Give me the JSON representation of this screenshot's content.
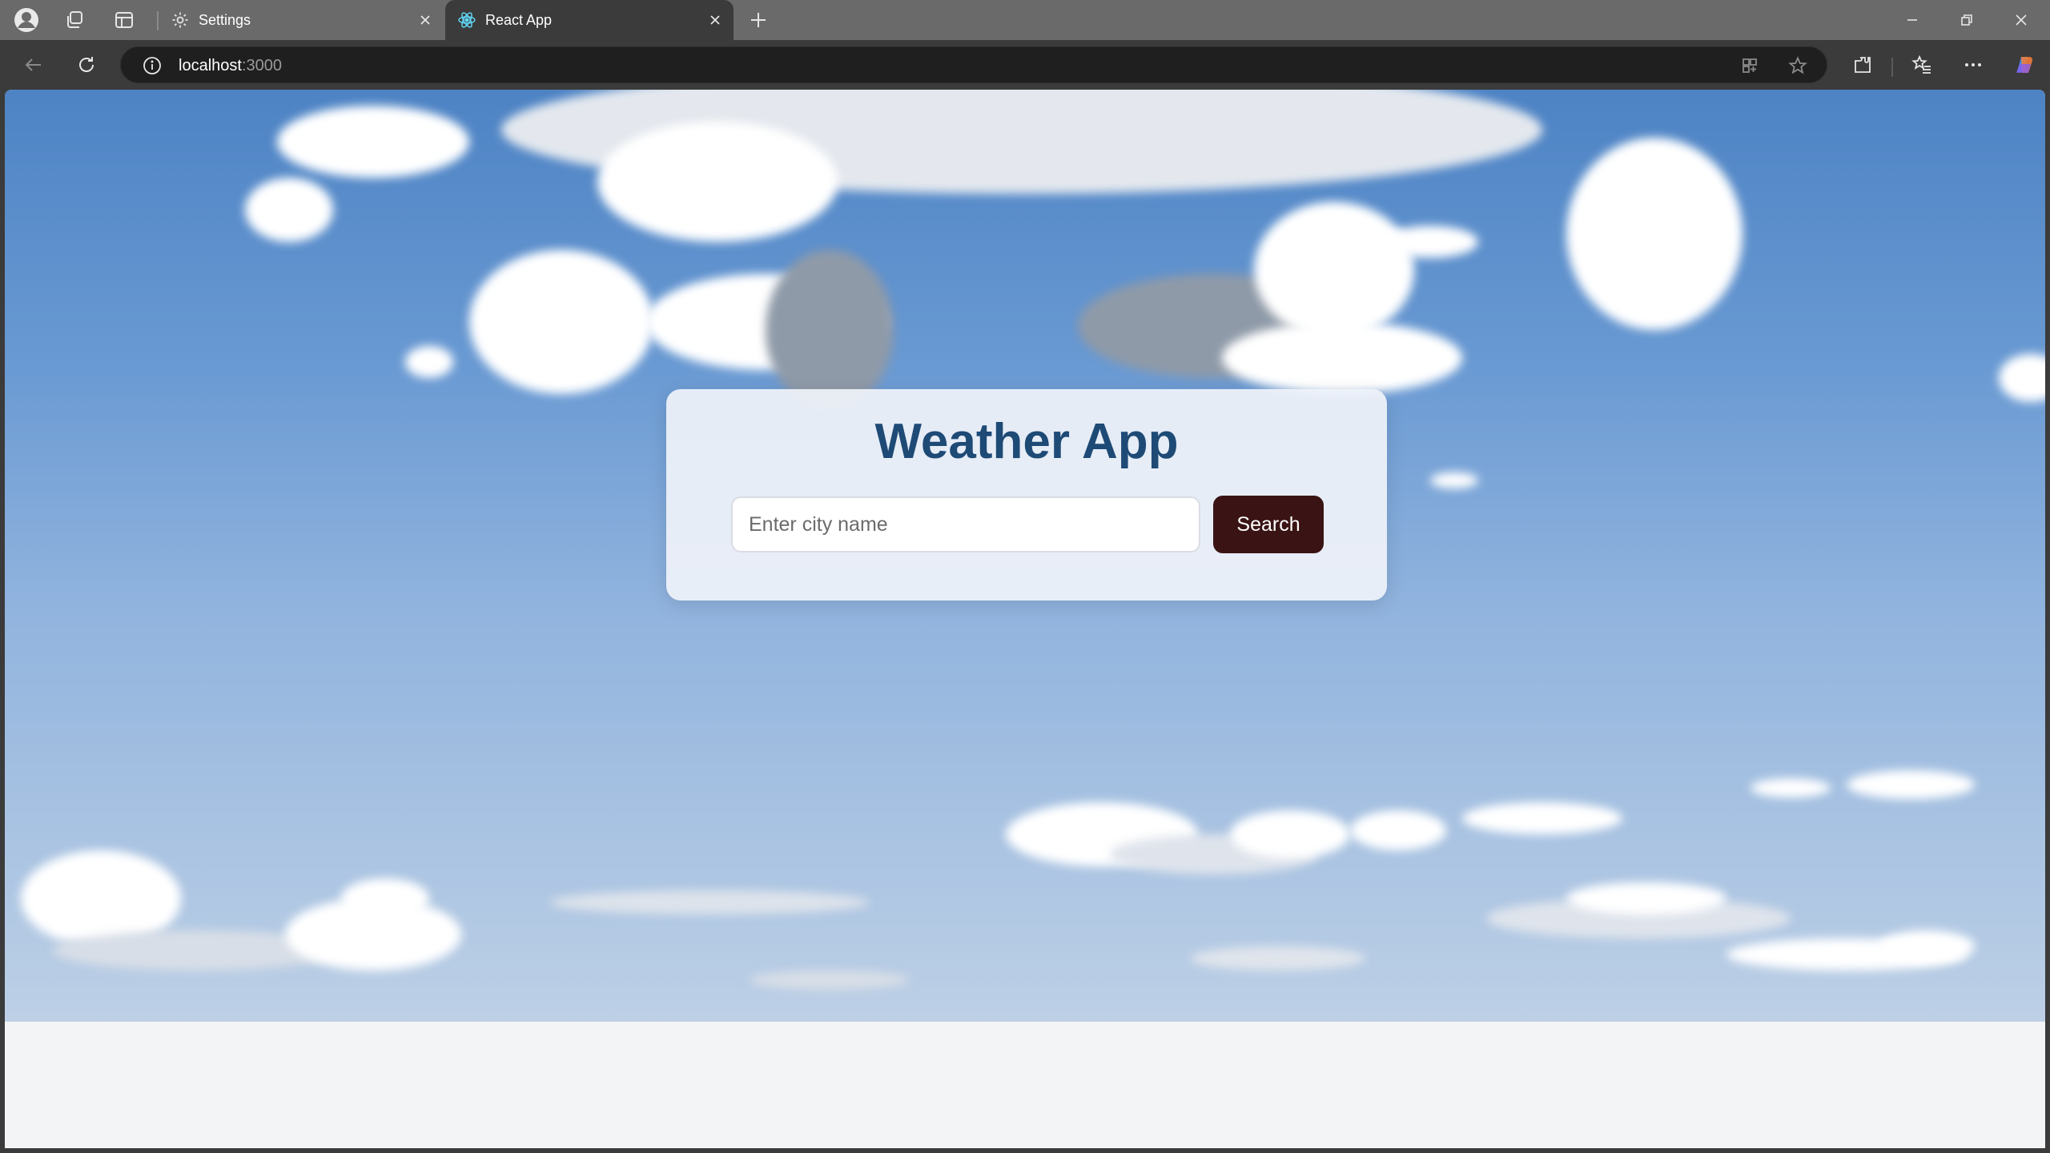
{
  "browser": {
    "tabs": [
      {
        "title": "Settings",
        "icon": "gear-icon",
        "active": false
      },
      {
        "title": "React App",
        "icon": "react-icon",
        "active": true
      }
    ],
    "address": {
      "host": "localhost",
      "port": ":3000"
    }
  },
  "app": {
    "title": "Weather App",
    "search": {
      "placeholder": "Enter city name",
      "value": "",
      "button_label": "Search"
    }
  },
  "colors": {
    "title": "#1e4a76",
    "button": "#3a1414"
  }
}
